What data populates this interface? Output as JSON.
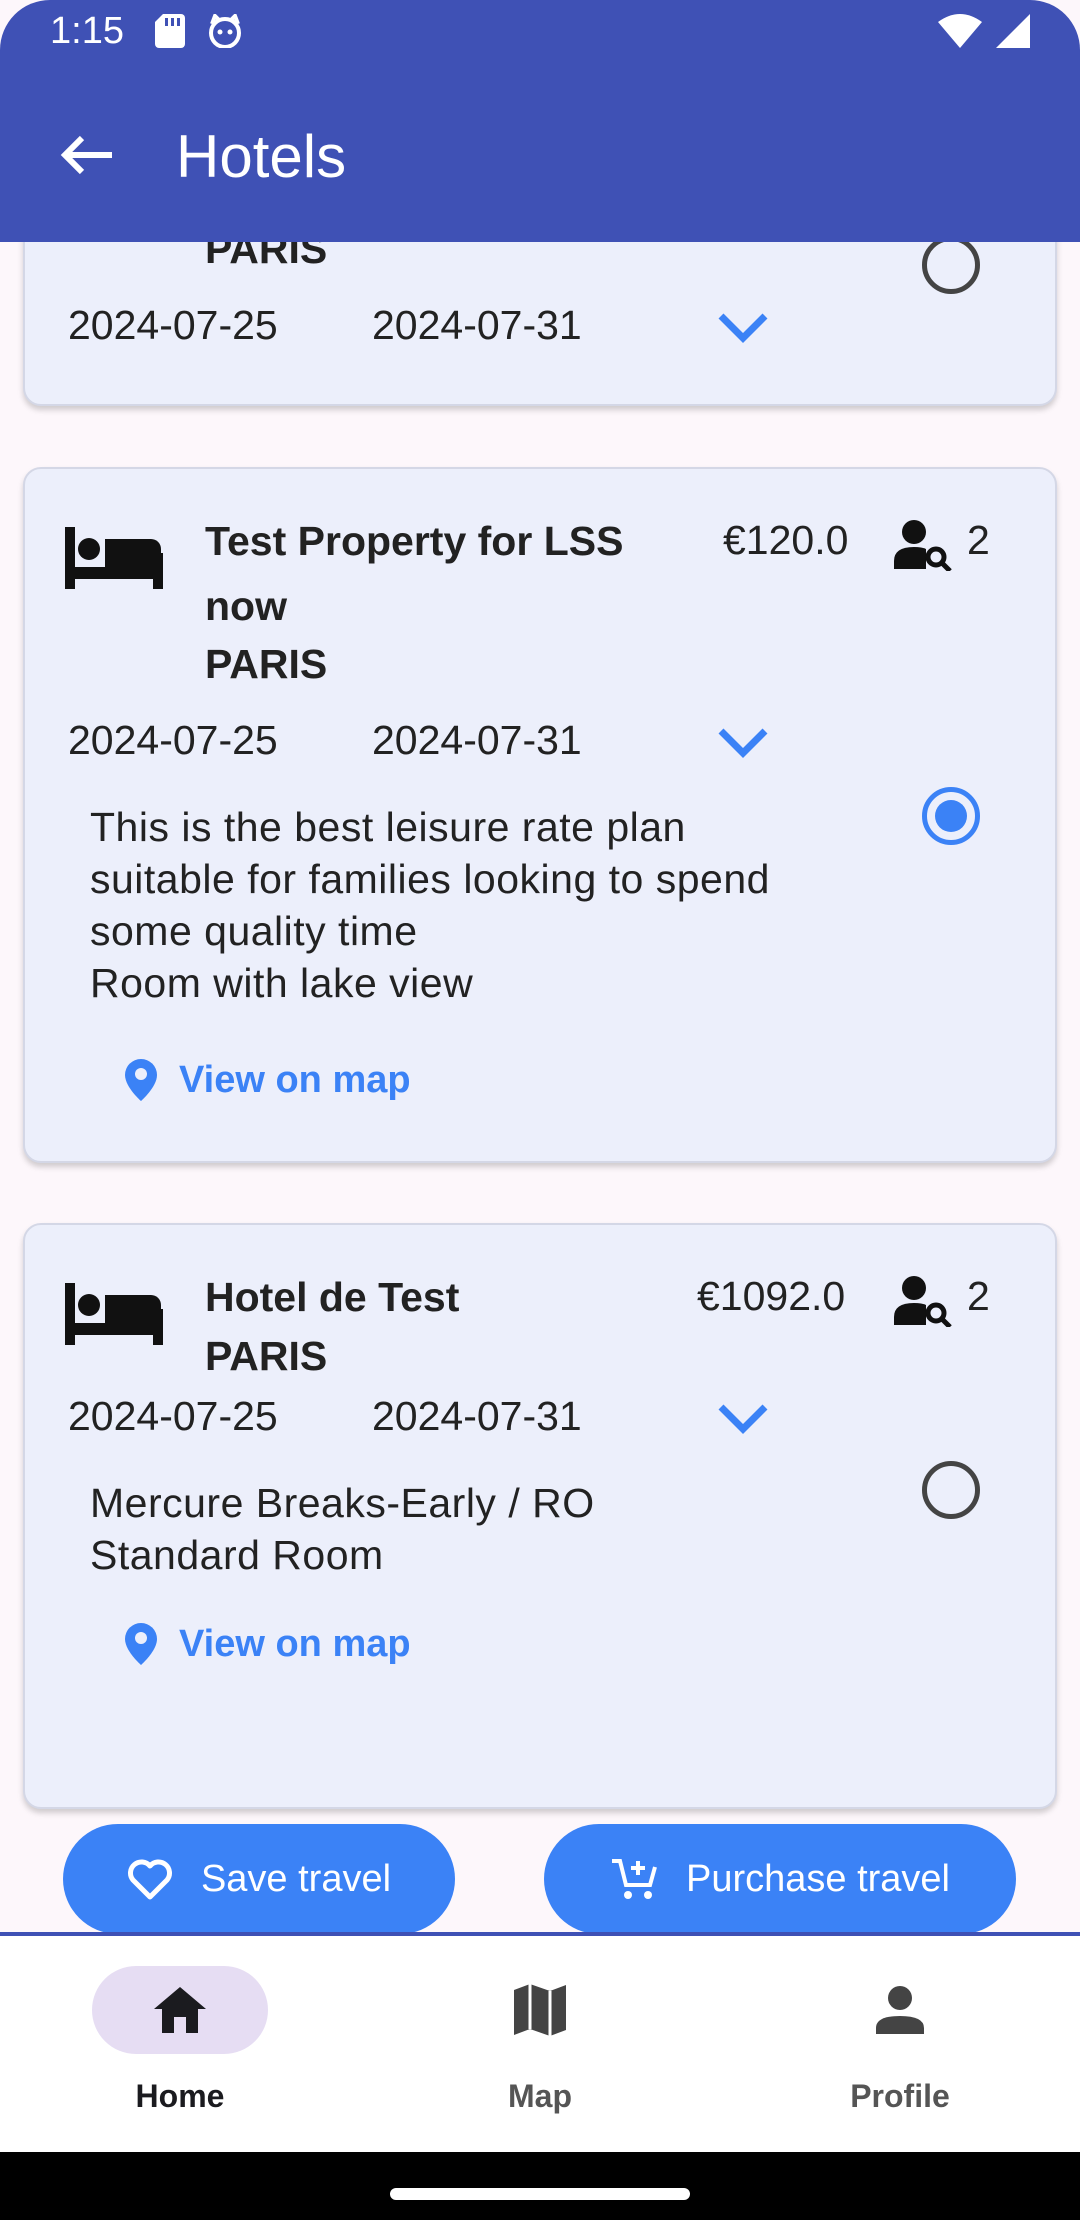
{
  "status_bar": {
    "time": "1:15"
  },
  "app_bar": {
    "title": "Hotels"
  },
  "hotels": [
    {
      "city": "PARIS",
      "check_in": "2024-07-25",
      "check_out": "2024-07-31",
      "selected": false
    },
    {
      "name_line1": "Test Property for LSS",
      "name_line2": "now",
      "city": "PARIS",
      "price": "€120.0",
      "guests": "2",
      "check_in": "2024-07-25",
      "check_out": "2024-07-31",
      "description": [
        "This is the best leisure rate plan",
        "suitable for families looking to spend",
        "some quality time",
        "Room with lake view"
      ],
      "map_link": "View on map",
      "selected": true
    },
    {
      "name_line1": "Hotel de Test",
      "city": "PARIS",
      "price": "€1092.0",
      "guests": "2",
      "check_in": "2024-07-25",
      "check_out": "2024-07-31",
      "description": [
        "Mercure Breaks-Early / RO",
        "Standard Room"
      ],
      "map_link": "View on map",
      "selected": false
    }
  ],
  "actions": {
    "save_label": "Save travel",
    "purchase_label": "Purchase travel"
  },
  "bottom_nav": [
    {
      "label": "Home",
      "icon": "home-icon",
      "active": true
    },
    {
      "label": "Map",
      "icon": "map-icon",
      "active": false
    },
    {
      "label": "Profile",
      "icon": "person-icon",
      "active": false
    }
  ],
  "colors": {
    "primary": "#3f51b5",
    "accent": "#3b82f6",
    "card": "#eceffb",
    "nav_indicator": "#e6ddf3"
  }
}
